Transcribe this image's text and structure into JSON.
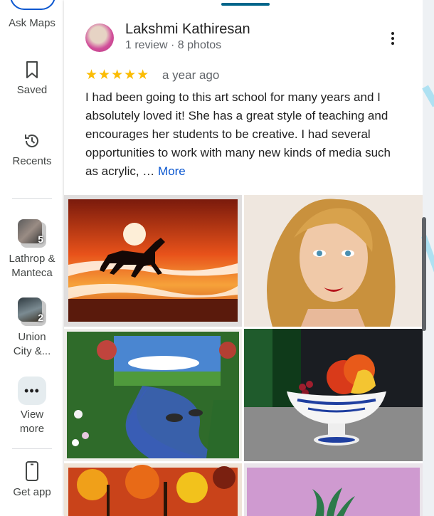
{
  "rail": {
    "ask_maps_label": "Ask Maps",
    "saved_label": "Saved",
    "recents_label": "Recents",
    "collections": [
      {
        "label_line1": "Lathrop &",
        "label_line2": "Manteca",
        "count": "5"
      },
      {
        "label_line1": "Union",
        "label_line2": "City &...",
        "count": "2"
      }
    ],
    "view_more_line1": "View",
    "view_more_line2": "more",
    "get_app_label": "Get app"
  },
  "review": {
    "author": "Lakshmi Kathiresan",
    "meta": "1 review · 8 photos",
    "stars": "★★★★★",
    "rating": 5,
    "time_ago": "a year ago",
    "text": "I had been going to this art school for many years and I absolutely loved it! She has a great style of teaching and encourages her students to be creative. I had several opportunities to work with many new kinds of media such as acrylic, … ",
    "more_label": "More"
  },
  "photos": [
    {
      "subject": "horse-sunset-painting"
    },
    {
      "subject": "portrait-painting"
    },
    {
      "subject": "river-landscape-painting"
    },
    {
      "subject": "fruit-bowl-painting"
    },
    {
      "subject": "autumn-trees-painting"
    },
    {
      "subject": "pink-plant-painting"
    }
  ],
  "colors": {
    "accent": "#0b57d0",
    "star": "#fbbc04",
    "tab_indicator": "#00658a"
  }
}
